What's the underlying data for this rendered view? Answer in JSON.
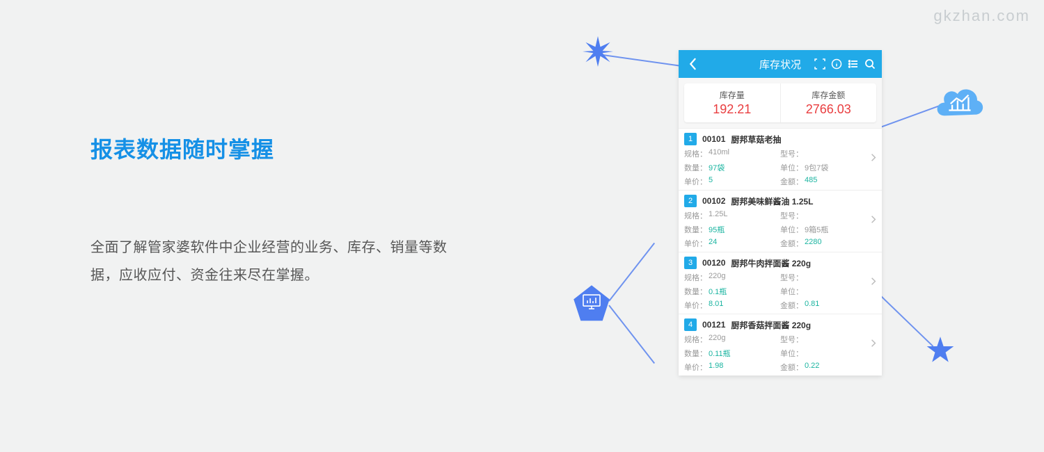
{
  "watermark": "gkzhan.com",
  "left": {
    "headline": "报表数据随时掌握",
    "body": "全面了解管家婆软件中企业经营的业务、库存、销量等数据，应收应付、资金往来尽在掌握。"
  },
  "phone": {
    "title": "库存状况",
    "summary": {
      "leftLabel": "库存量",
      "leftValue": "192.21",
      "rightLabel": "库存金额",
      "rightValue": "2766.03"
    },
    "labels": {
      "spec": "规格：",
      "qty": "数量：",
      "price": "单价：",
      "model": "型号：",
      "unit": "单位：",
      "amount": "金额："
    },
    "items": [
      {
        "num": "1",
        "code": "00101",
        "name": "厨邦草菇老抽",
        "spec": "410ml",
        "model": "",
        "qty": "97袋",
        "unit": "9包7袋",
        "price": "5",
        "amount": "485"
      },
      {
        "num": "2",
        "code": "00102",
        "name": "厨邦美味鲜酱油 1.25L",
        "spec": "1.25L",
        "model": "",
        "qty": "95瓶",
        "unit": "9箱5瓶",
        "price": "24",
        "amount": "2280"
      },
      {
        "num": "3",
        "code": "00120",
        "name": "厨邦牛肉拌面酱 220g",
        "spec": "220g",
        "model": "",
        "qty": "0.1瓶",
        "unit": "",
        "price": "8.01",
        "amount": "0.81"
      },
      {
        "num": "4",
        "code": "00121",
        "name": "厨邦香菇拌面酱 220g",
        "spec": "220g",
        "model": "",
        "qty": "0.11瓶",
        "unit": "",
        "price": "1.98",
        "amount": "0.22"
      }
    ]
  }
}
